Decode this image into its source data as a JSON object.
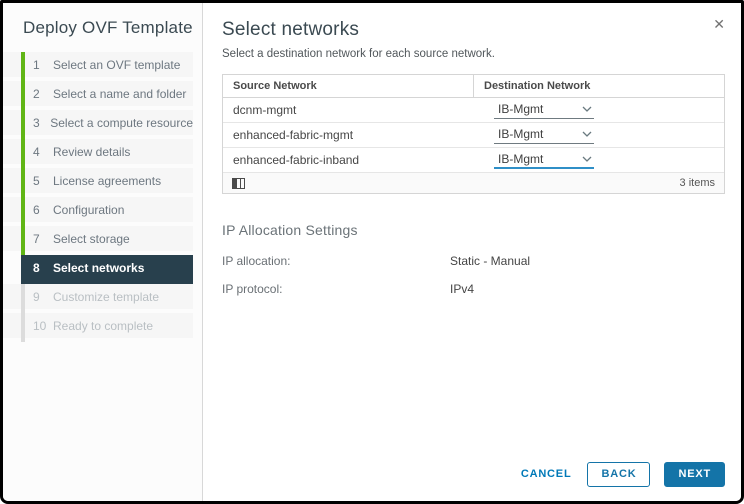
{
  "wizard": {
    "title": "Deploy OVF Template",
    "steps": [
      {
        "num": "1",
        "label": "Select an OVF template",
        "state": "done"
      },
      {
        "num": "2",
        "label": "Select a name and folder",
        "state": "done"
      },
      {
        "num": "3",
        "label": "Select a compute resource",
        "state": "done"
      },
      {
        "num": "4",
        "label": "Review details",
        "state": "done"
      },
      {
        "num": "5",
        "label": "License agreements",
        "state": "done"
      },
      {
        "num": "6",
        "label": "Configuration",
        "state": "done"
      },
      {
        "num": "7",
        "label": "Select storage",
        "state": "done"
      },
      {
        "num": "8",
        "label": "Select networks",
        "state": "active"
      },
      {
        "num": "9",
        "label": "Customize template",
        "state": "todo"
      },
      {
        "num": "10",
        "label": "Ready to complete",
        "state": "todo"
      }
    ]
  },
  "panel": {
    "title": "Select networks",
    "subtitle": "Select a destination network for each source network.",
    "close_icon": "✕"
  },
  "network_table": {
    "columns": {
      "source": "Source Network",
      "destination": "Destination Network"
    },
    "rows": [
      {
        "source": "dcnm-mgmt",
        "destination": "IB-Mgmt",
        "focused": false
      },
      {
        "source": "enhanced-fabric-mgmt",
        "destination": "IB-Mgmt",
        "focused": false
      },
      {
        "source": "enhanced-fabric-inband",
        "destination": "IB-Mgmt",
        "focused": true
      }
    ],
    "footer": {
      "items_count": "3 items",
      "icon": "column-picker-icon"
    }
  },
  "ip_settings": {
    "heading": "IP Allocation Settings",
    "rows": [
      {
        "label": "IP allocation:",
        "value": "Static - Manual"
      },
      {
        "label": "IP protocol:",
        "value": "IPv4"
      }
    ]
  },
  "footer_buttons": {
    "cancel": "CANCEL",
    "back": "BACK",
    "next": "NEXT"
  },
  "colors": {
    "progress_green": "#60b515",
    "active_step_bg": "#28404d",
    "accent_blue": "#1474a8",
    "link_blue": "#0079b8",
    "focus_underline": "#2f8fc7"
  }
}
